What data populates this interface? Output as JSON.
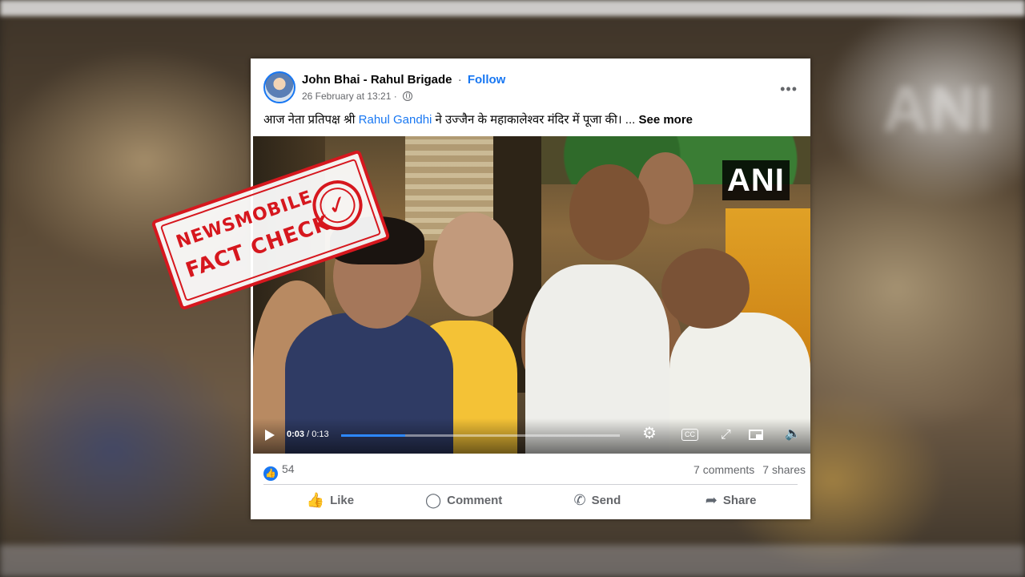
{
  "post": {
    "author": "John Bhai - Rahul Brigade",
    "separator": "·",
    "follow_label": "Follow",
    "timestamp": "26 February at 13:21 ·",
    "more_label": "•••",
    "text_before": "आज नेता प्रतिपक्ष श्री ",
    "text_mention": "Rahul Gandhi",
    "text_after": " ने उज्जैन के महाकालेश्वर मंदिर में पूजा की। ... ",
    "see_more": "See more"
  },
  "video": {
    "watermark": "ANI",
    "current_time": "0:03",
    "total_time": " / 0:13",
    "progress": 0.23,
    "cc_label": "CC"
  },
  "footer": {
    "like_count": "54",
    "comments": "7 comments",
    "shares": "7 shares",
    "actions": [
      {
        "icon": "👍",
        "label": "Like"
      },
      {
        "icon": "◯",
        "label": "Comment"
      },
      {
        "icon": "✆",
        "label": "Send"
      },
      {
        "icon": "➦",
        "label": "Share"
      }
    ]
  },
  "stamp": {
    "line1": "NEWSMOBILE",
    "line2": "FACT CHECK",
    "check": "✓"
  },
  "colors": {
    "brand": "#1877f2",
    "stamp_red": "#d6171e",
    "progress": "#2d88ff"
  }
}
